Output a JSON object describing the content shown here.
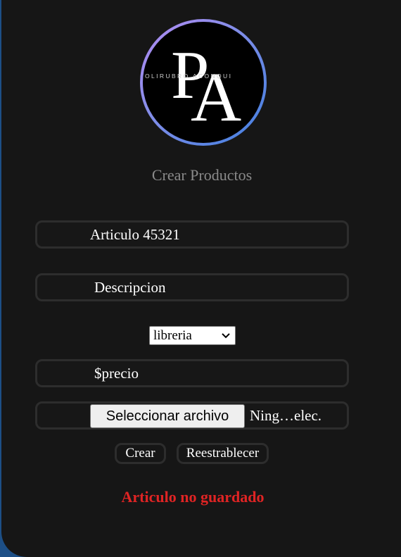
{
  "logo": {
    "monogram_p": "P",
    "monogram_a": "A",
    "ring_text": "OLIRUBRO ACONQUI"
  },
  "header": {
    "title": "Crear Productos"
  },
  "form": {
    "article": {
      "value": "Articulo 45321"
    },
    "description": {
      "placeholder": "Descripcion"
    },
    "category": {
      "selected": "libreria"
    },
    "price": {
      "placeholder": "$precio"
    },
    "file": {
      "button_label": "Seleccionar archivo",
      "status": "Ning…elec."
    },
    "buttons": {
      "create": "Crear",
      "reset": "Reestrablecer"
    }
  },
  "status_message": {
    "text": "Articulo no guardado",
    "color": "#e02424"
  },
  "colors": {
    "background": "#161616",
    "accent_blue": "#1d4f86",
    "ring_purple": "#b58cf2",
    "ring_blue": "#3f7fe0"
  }
}
